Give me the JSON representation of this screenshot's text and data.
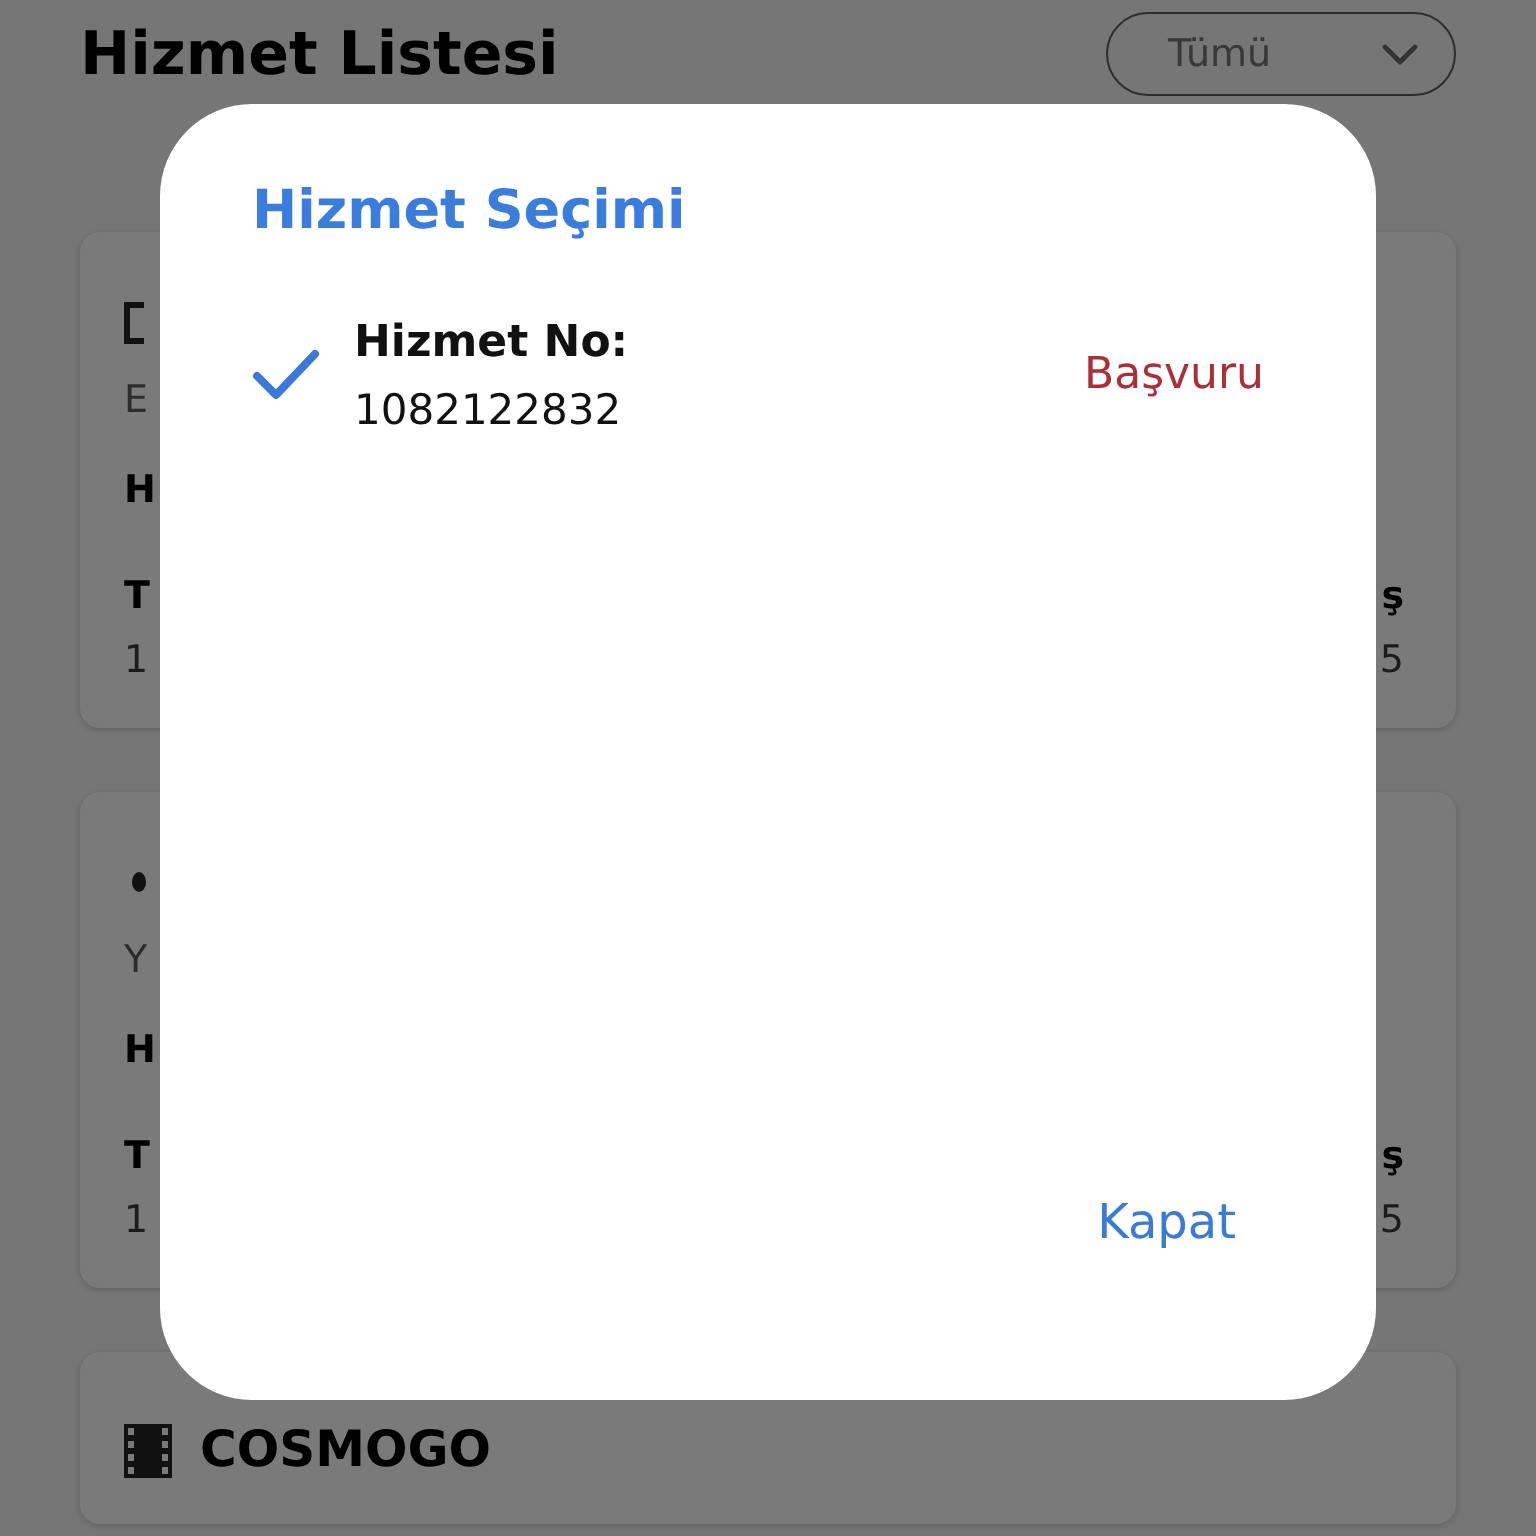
{
  "page": {
    "title": "Hizmet Listesi",
    "filter": {
      "value": "Tümü"
    }
  },
  "cards": [
    {
      "kind": "rectangle",
      "subtitle": "E",
      "name": "H",
      "left_label": "T",
      "left_value": "1",
      "right_label": "ş",
      "right_value": "5"
    },
    {
      "kind": "dot",
      "subtitle": "Y",
      "name": "H",
      "left_label": "T",
      "left_value": "1",
      "right_label": "ş",
      "right_value": "5"
    },
    {
      "kind": "film",
      "title": "COSMOGO"
    }
  ],
  "dialog": {
    "title": "Hizmet Seçimi",
    "items": [
      {
        "label": "Hizmet No:",
        "number": "1082122832",
        "status": "Başvuru",
        "selected": true
      }
    ],
    "buttons": [
      "Kapat"
    ]
  }
}
